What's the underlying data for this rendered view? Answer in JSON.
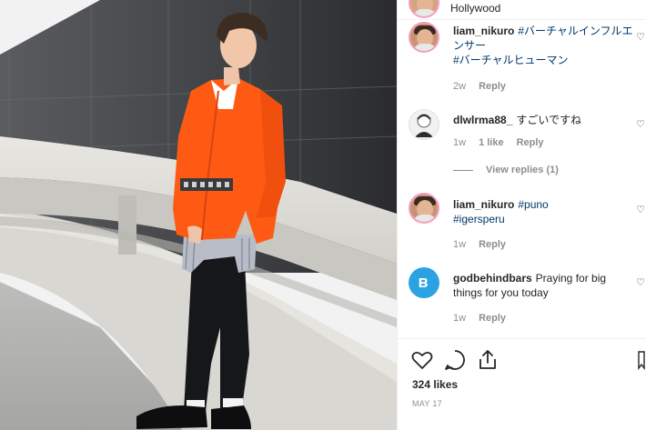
{
  "post": {
    "location": "Hollywood",
    "likes": "324 likes",
    "date": "MAY 17",
    "icons": {
      "like": "heart-outline-icon",
      "comment": "speech-bubble-icon",
      "share": "share-upload-icon",
      "save": "bookmark-icon"
    }
  },
  "comments": [
    {
      "user": "liam_nikuro",
      "text_tag1": "#バーチャルインフルエンサー",
      "text_tag2": "#バーチャルヒューマン",
      "time": "2w",
      "likes": "",
      "reply": "Reply"
    },
    {
      "user": "dlwlrma88_",
      "text": "すごいですね",
      "time": "1w",
      "likes": "1 like",
      "reply": "Reply",
      "view_replies": "View replies (1)"
    },
    {
      "user": "liam_nikuro",
      "text_tag1": "#puno",
      "text_tag2": "#igersperu",
      "time": "1w",
      "likes": "",
      "reply": "Reply"
    },
    {
      "user": "godbehindbars",
      "text": "Praying for big things for you today",
      "time": "1w",
      "likes": "",
      "reply": "Reply"
    }
  ],
  "colors": {
    "jacket": "#ff5a14",
    "link": "#00376b",
    "meta": "#8e8e8e",
    "story_ring": "#f3a0c0",
    "blue_avatar": "#2ba3e3"
  }
}
